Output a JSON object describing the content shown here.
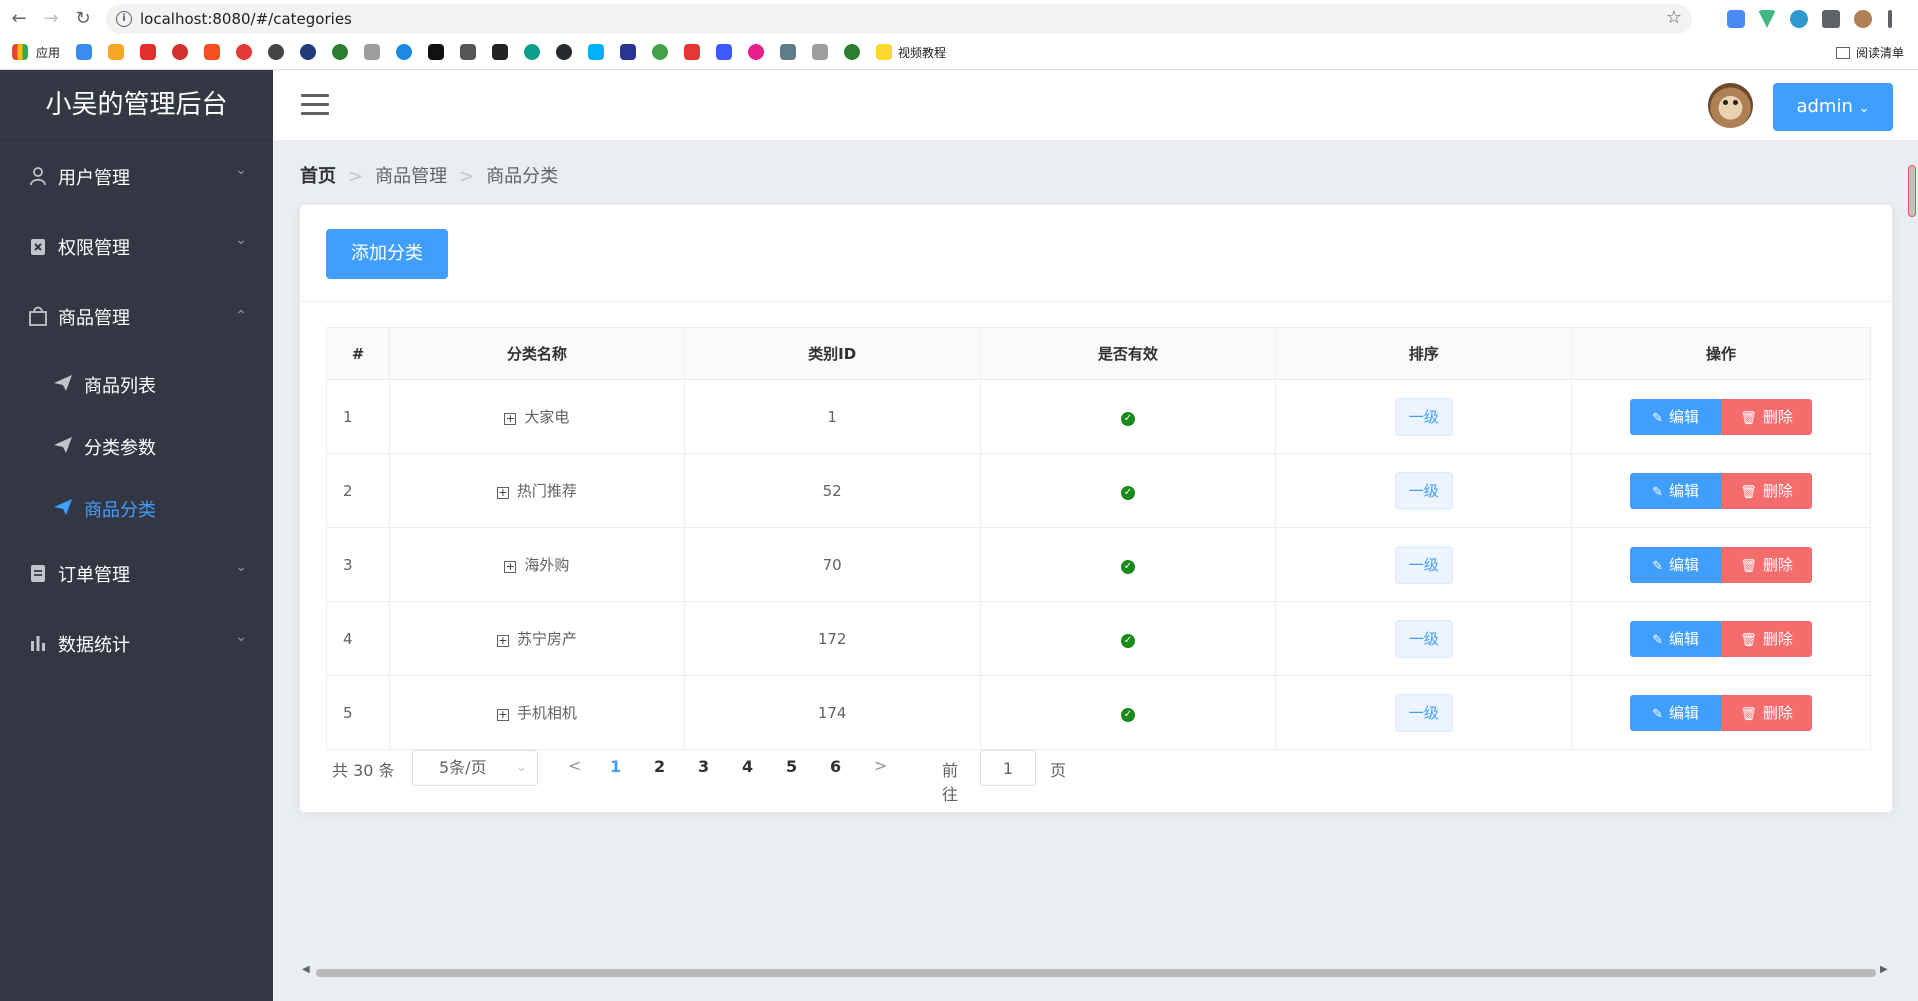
{
  "browser": {
    "url": "localhost:8080/#/categories",
    "bookmarks": {
      "apps_label": "应用",
      "video_label": "视频教程",
      "reading_list_label": "阅读清单"
    }
  },
  "sidebar": {
    "brand": "小吴的管理后台",
    "menus": [
      {
        "label": "用户管理",
        "icon": "user-icon"
      },
      {
        "label": "权限管理",
        "icon": "permission-icon"
      },
      {
        "label": "商品管理",
        "icon": "shopping-bag-icon"
      },
      {
        "label": "订单管理",
        "icon": "order-icon"
      },
      {
        "label": "数据统计",
        "icon": "bar-chart-icon"
      }
    ],
    "submenu": [
      {
        "label": "商品列表"
      },
      {
        "label": "分类参数"
      },
      {
        "label": "商品分类"
      }
    ],
    "active_color": "#409eff"
  },
  "header": {
    "user": "admin"
  },
  "breadcrumb": {
    "home": "首页",
    "level1": "商品管理",
    "level2": "商品分类"
  },
  "main": {
    "add_button": "添加分类",
    "table": {
      "headers": {
        "index": "#",
        "name": "分类名称",
        "id": "类别ID",
        "valid": "是否有效",
        "order": "排序",
        "ops": "操作"
      },
      "rows": [
        {
          "index": "1",
          "name": "大家电",
          "id": "1",
          "level": "一级"
        },
        {
          "index": "2",
          "name": "热门推荐",
          "id": "52",
          "level": "一级"
        },
        {
          "index": "3",
          "name": "海外购",
          "id": "70",
          "level": "一级"
        },
        {
          "index": "4",
          "name": "苏宁房产",
          "id": "172",
          "level": "一级"
        },
        {
          "index": "5",
          "name": "手机相机",
          "id": "174",
          "level": "一级"
        }
      ],
      "edit_label": "编辑",
      "delete_label": "删除"
    },
    "pagination": {
      "total": "共 30 条",
      "page_size": "5条/页",
      "pages": [
        "1",
        "2",
        "3",
        "4",
        "5",
        "6"
      ],
      "current": "1",
      "goto_label": "前往",
      "goto_value": "1",
      "page_unit": "页"
    }
  },
  "colors": {
    "primary": "#409eff",
    "danger": "#f56c6c",
    "success": "#1a8a1a",
    "sidebar_bg": "#333744"
  }
}
